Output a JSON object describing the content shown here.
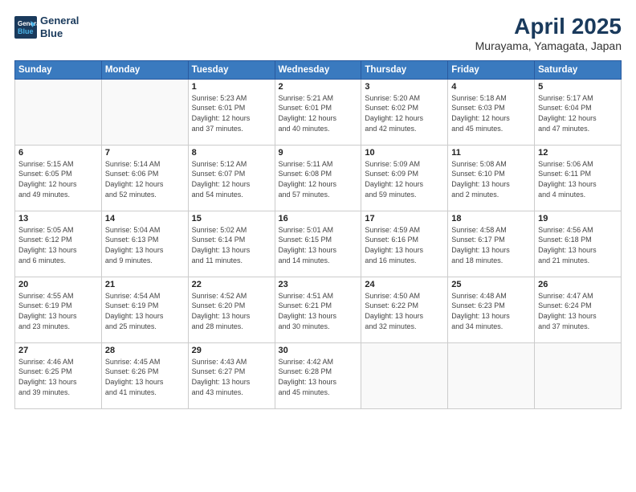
{
  "header": {
    "logo_line1": "General",
    "logo_line2": "Blue",
    "title": "April 2025",
    "subtitle": "Murayama, Yamagata, Japan"
  },
  "weekdays": [
    "Sunday",
    "Monday",
    "Tuesday",
    "Wednesday",
    "Thursday",
    "Friday",
    "Saturday"
  ],
  "weeks": [
    [
      {
        "day": "",
        "info": ""
      },
      {
        "day": "",
        "info": ""
      },
      {
        "day": "1",
        "info": "Sunrise: 5:23 AM\nSunset: 6:01 PM\nDaylight: 12 hours\nand 37 minutes."
      },
      {
        "day": "2",
        "info": "Sunrise: 5:21 AM\nSunset: 6:01 PM\nDaylight: 12 hours\nand 40 minutes."
      },
      {
        "day": "3",
        "info": "Sunrise: 5:20 AM\nSunset: 6:02 PM\nDaylight: 12 hours\nand 42 minutes."
      },
      {
        "day": "4",
        "info": "Sunrise: 5:18 AM\nSunset: 6:03 PM\nDaylight: 12 hours\nand 45 minutes."
      },
      {
        "day": "5",
        "info": "Sunrise: 5:17 AM\nSunset: 6:04 PM\nDaylight: 12 hours\nand 47 minutes."
      }
    ],
    [
      {
        "day": "6",
        "info": "Sunrise: 5:15 AM\nSunset: 6:05 PM\nDaylight: 12 hours\nand 49 minutes."
      },
      {
        "day": "7",
        "info": "Sunrise: 5:14 AM\nSunset: 6:06 PM\nDaylight: 12 hours\nand 52 minutes."
      },
      {
        "day": "8",
        "info": "Sunrise: 5:12 AM\nSunset: 6:07 PM\nDaylight: 12 hours\nand 54 minutes."
      },
      {
        "day": "9",
        "info": "Sunrise: 5:11 AM\nSunset: 6:08 PM\nDaylight: 12 hours\nand 57 minutes."
      },
      {
        "day": "10",
        "info": "Sunrise: 5:09 AM\nSunset: 6:09 PM\nDaylight: 12 hours\nand 59 minutes."
      },
      {
        "day": "11",
        "info": "Sunrise: 5:08 AM\nSunset: 6:10 PM\nDaylight: 13 hours\nand 2 minutes."
      },
      {
        "day": "12",
        "info": "Sunrise: 5:06 AM\nSunset: 6:11 PM\nDaylight: 13 hours\nand 4 minutes."
      }
    ],
    [
      {
        "day": "13",
        "info": "Sunrise: 5:05 AM\nSunset: 6:12 PM\nDaylight: 13 hours\nand 6 minutes."
      },
      {
        "day": "14",
        "info": "Sunrise: 5:04 AM\nSunset: 6:13 PM\nDaylight: 13 hours\nand 9 minutes."
      },
      {
        "day": "15",
        "info": "Sunrise: 5:02 AM\nSunset: 6:14 PM\nDaylight: 13 hours\nand 11 minutes."
      },
      {
        "day": "16",
        "info": "Sunrise: 5:01 AM\nSunset: 6:15 PM\nDaylight: 13 hours\nand 14 minutes."
      },
      {
        "day": "17",
        "info": "Sunrise: 4:59 AM\nSunset: 6:16 PM\nDaylight: 13 hours\nand 16 minutes."
      },
      {
        "day": "18",
        "info": "Sunrise: 4:58 AM\nSunset: 6:17 PM\nDaylight: 13 hours\nand 18 minutes."
      },
      {
        "day": "19",
        "info": "Sunrise: 4:56 AM\nSunset: 6:18 PM\nDaylight: 13 hours\nand 21 minutes."
      }
    ],
    [
      {
        "day": "20",
        "info": "Sunrise: 4:55 AM\nSunset: 6:19 PM\nDaylight: 13 hours\nand 23 minutes."
      },
      {
        "day": "21",
        "info": "Sunrise: 4:54 AM\nSunset: 6:19 PM\nDaylight: 13 hours\nand 25 minutes."
      },
      {
        "day": "22",
        "info": "Sunrise: 4:52 AM\nSunset: 6:20 PM\nDaylight: 13 hours\nand 28 minutes."
      },
      {
        "day": "23",
        "info": "Sunrise: 4:51 AM\nSunset: 6:21 PM\nDaylight: 13 hours\nand 30 minutes."
      },
      {
        "day": "24",
        "info": "Sunrise: 4:50 AM\nSunset: 6:22 PM\nDaylight: 13 hours\nand 32 minutes."
      },
      {
        "day": "25",
        "info": "Sunrise: 4:48 AM\nSunset: 6:23 PM\nDaylight: 13 hours\nand 34 minutes."
      },
      {
        "day": "26",
        "info": "Sunrise: 4:47 AM\nSunset: 6:24 PM\nDaylight: 13 hours\nand 37 minutes."
      }
    ],
    [
      {
        "day": "27",
        "info": "Sunrise: 4:46 AM\nSunset: 6:25 PM\nDaylight: 13 hours\nand 39 minutes."
      },
      {
        "day": "28",
        "info": "Sunrise: 4:45 AM\nSunset: 6:26 PM\nDaylight: 13 hours\nand 41 minutes."
      },
      {
        "day": "29",
        "info": "Sunrise: 4:43 AM\nSunset: 6:27 PM\nDaylight: 13 hours\nand 43 minutes."
      },
      {
        "day": "30",
        "info": "Sunrise: 4:42 AM\nSunset: 6:28 PM\nDaylight: 13 hours\nand 45 minutes."
      },
      {
        "day": "",
        "info": ""
      },
      {
        "day": "",
        "info": ""
      },
      {
        "day": "",
        "info": ""
      }
    ]
  ]
}
